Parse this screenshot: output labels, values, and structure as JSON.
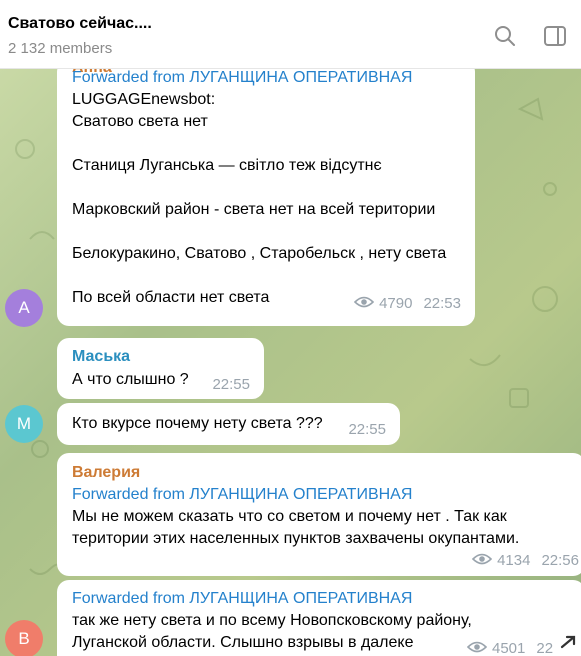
{
  "header": {
    "title": "Сватово сейчас....",
    "members": "2 132 members"
  },
  "colors": {
    "avatar_a": "#a47fdc",
    "avatar_m": "#5bc7d0",
    "avatar_b": "#f07d6a",
    "link": "#2481cc",
    "sender_orange": "#cd7b35"
  },
  "messages": [
    {
      "sender_partial": "Анна",
      "forwarded": "Forwarded from ЛУГАНЩИНА ОПЕРАТИВНАЯ",
      "lines": [
        "LUGGAGEnewsbot:",
        "Сватово света нет",
        "Станиця Луганська — світло теж відсутнє",
        "Марковский район - света нет на всей територии",
        "Белокуракино, Сватово , Старобельск , нету света",
        "По всей области нет света"
      ],
      "views": "4790",
      "time": "22:53",
      "avatar": "A"
    },
    {
      "sender": "Маська",
      "text": "А что слышно  ?",
      "time": "22:55"
    },
    {
      "text": "Кто вкурсе почему нету света  ???",
      "time": "22:55",
      "avatar": "M"
    },
    {
      "sender": "Валерия",
      "forwarded": "Forwarded from ЛУГАНЩИНА ОПЕРАТИВНАЯ",
      "lines": [
        "Мы не можем сказать что со светом и почему нет . Так как",
        "територии этих населенных пунктов захвачены окупантами."
      ],
      "views": "4134",
      "time": "22:56"
    },
    {
      "forwarded": "Forwarded from ЛУГАНЩИНА ОПЕРАТИВНАЯ",
      "lines": [
        "так же нету света и по всему Новопсковскому району,",
        "Луганской области. Слышно взрывы в далеке"
      ],
      "views": "4501",
      "time": "22",
      "avatar": "B"
    }
  ]
}
